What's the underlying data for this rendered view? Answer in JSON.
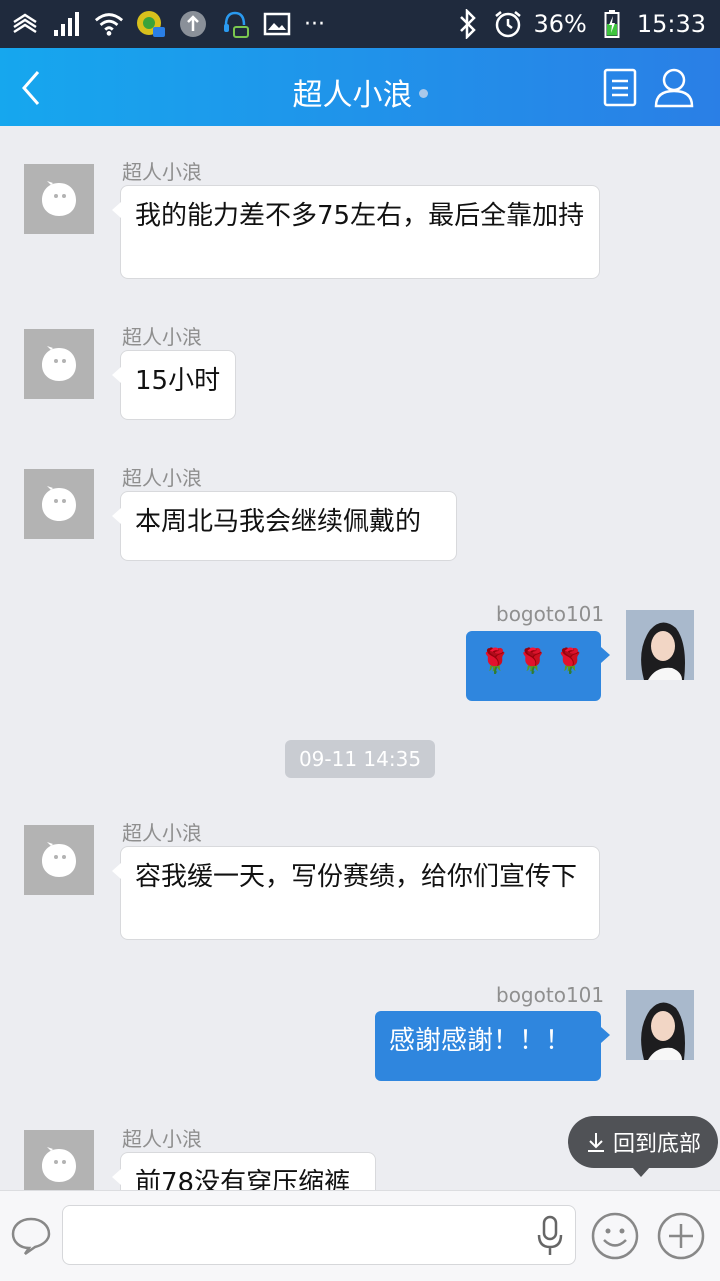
{
  "status_bar": {
    "battery_percent": "36%",
    "time": "15:33",
    "more_indicator": "···"
  },
  "header": {
    "title": "超人小浪"
  },
  "messages": [
    {
      "side": "left",
      "sender": "超人小浪",
      "text": "我的能力差不多75左右，最后全靠加持"
    },
    {
      "side": "left",
      "sender": "超人小浪",
      "text": "15小时"
    },
    {
      "side": "left",
      "sender": "超人小浪",
      "text": "本周北马我会继续佩戴的"
    },
    {
      "side": "right",
      "sender": "bogoto101",
      "text": "🌹 🌹 🌹"
    },
    {
      "side": "left",
      "sender": "超人小浪",
      "text": "容我缓一天，写份赛绩，给你们宣传下"
    },
    {
      "side": "right",
      "sender": "bogoto101",
      "text": "感謝感謝！！！"
    },
    {
      "side": "left",
      "sender": "超人小浪",
      "text": "前78没有穿压缩裤"
    }
  ],
  "timestamp": "09-11 14:35",
  "scroll_to_bottom_label": "回到底部",
  "input": {
    "value": "",
    "placeholder": ""
  },
  "colors": {
    "header_start": "#16a7ee",
    "header_end": "#2a7fe6",
    "own_bubble": "#2f86de",
    "background": "#ecedf1"
  }
}
